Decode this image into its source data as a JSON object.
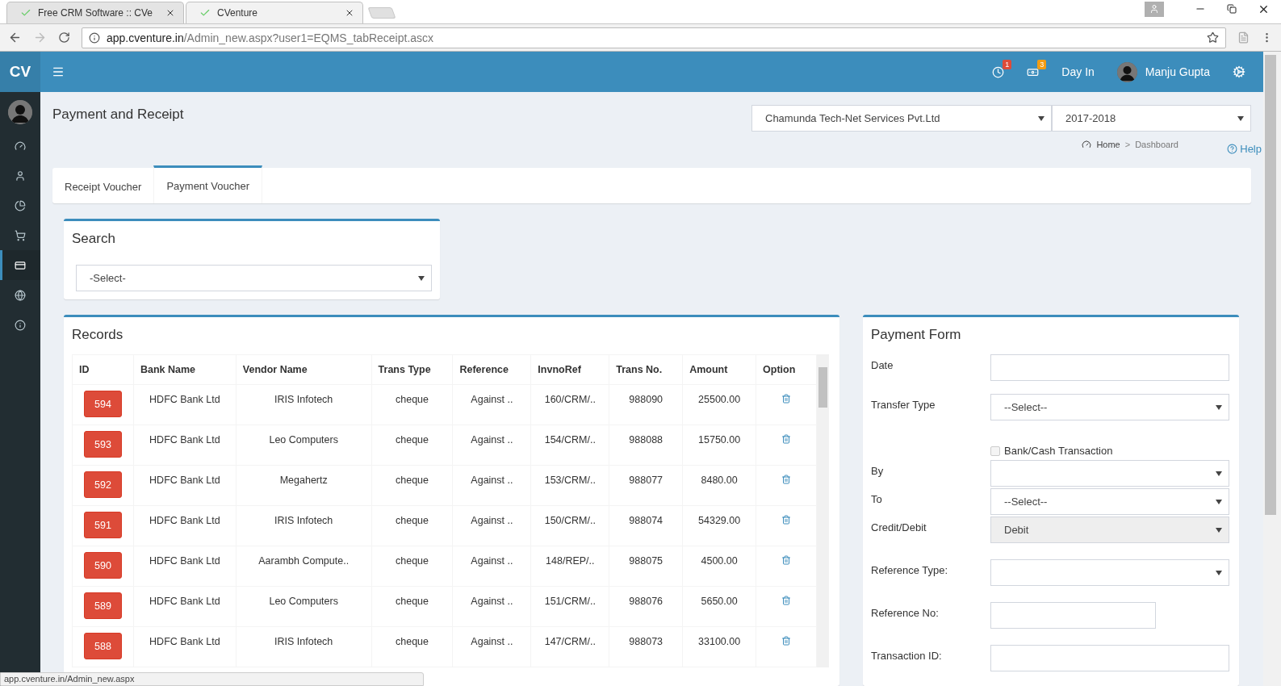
{
  "browser": {
    "tabs": [
      {
        "title": "Free CRM Software :: CVe",
        "selected": false
      },
      {
        "title": "CVenture",
        "selected": true
      }
    ],
    "url_host": "app.cventure.in",
    "url_path": "/Admin_new.aspx?user1=EQMS_tabReceipt.ascx",
    "status_text": "app.cventure.in/Admin_new.aspx"
  },
  "app": {
    "logo": "CV",
    "notifications": [
      {
        "kind": "clock",
        "count": "1",
        "color": "#dd4b39"
      },
      {
        "kind": "money",
        "count": "3",
        "color": "#f39c12"
      }
    ],
    "day_in": "Day In",
    "user_name": "Manju Gupta"
  },
  "sidebar": {
    "items": [
      {
        "kind": "dashboard",
        "selected": false
      },
      {
        "kind": "user",
        "selected": false
      },
      {
        "kind": "chart",
        "selected": false
      },
      {
        "kind": "cart",
        "selected": false
      },
      {
        "kind": "card",
        "selected": true
      },
      {
        "kind": "globe",
        "selected": false
      },
      {
        "kind": "info",
        "selected": false
      }
    ]
  },
  "page": {
    "title": "Payment and Receipt",
    "company": "Chamunda Tech-Net Services Pvt.Ltd",
    "year": "2017-2018",
    "breadcrumb": [
      "Home",
      "Dashboard"
    ],
    "breadcrumb_separator": ">",
    "help": "Help"
  },
  "tabs": [
    {
      "label": "Receipt Voucher",
      "selected": false
    },
    {
      "label": "Payment Voucher",
      "selected": true
    }
  ],
  "search": {
    "title": "Search",
    "value": "-Select-"
  },
  "records": {
    "title": "Records",
    "columns": [
      "ID",
      "Bank Name",
      "Vendor Name",
      "Trans Type",
      "Reference",
      "InvnoRef",
      "Trans No.",
      "Amount",
      "Option"
    ],
    "rows": [
      [
        "594",
        "HDFC Bank Ltd",
        "IRIS Infotech",
        "cheque",
        "Against ..",
        "160/CRM/..",
        "988090",
        "25500.00"
      ],
      [
        "593",
        "HDFC Bank Ltd",
        "Leo Computers",
        "cheque",
        "Against ..",
        "154/CRM/..",
        "988088",
        "15750.00"
      ],
      [
        "592",
        "HDFC Bank Ltd",
        "Megahertz",
        "cheque",
        "Against ..",
        "153/CRM/..",
        "988077",
        "8480.00"
      ],
      [
        "591",
        "HDFC Bank Ltd",
        "IRIS Infotech",
        "cheque",
        "Against ..",
        "150/CRM/..",
        "988074",
        "54329.00"
      ],
      [
        "590",
        "HDFC Bank Ltd",
        "Aarambh Compute..",
        "cheque",
        "Against ..",
        "148/REP/..",
        "988075",
        "4500.00"
      ],
      [
        "589",
        "HDFC Bank Ltd",
        "Leo Computers",
        "cheque",
        "Against ..",
        "151/CRM/..",
        "988076",
        "5650.00"
      ],
      [
        "588",
        "HDFC Bank Ltd",
        "IRIS Infotech",
        "cheque",
        "Against ..",
        "147/CRM/..",
        "988073",
        "33100.00"
      ]
    ]
  },
  "form": {
    "title": "Payment Form",
    "fields": [
      {
        "kind": "input",
        "label": "Date"
      },
      {
        "kind": "select",
        "label": "Transfer Type",
        "value": "--Select--",
        "disabled": false
      },
      {
        "kind": "checkbox",
        "label": "Bank/Cash Transaction",
        "checked": false
      },
      {
        "kind": "select",
        "label": "By",
        "disabled": false
      },
      {
        "kind": "select",
        "label": "To",
        "value": "--Select--",
        "disabled": false
      },
      {
        "kind": "select",
        "label": "Credit/Debit",
        "value": "Debit",
        "disabled": true
      },
      {
        "kind": "select",
        "label": "Reference Type:",
        "disabled": false
      },
      {
        "kind": "input_short",
        "label": "Reference No:"
      },
      {
        "kind": "input",
        "label": "Transaction ID:"
      }
    ]
  }
}
